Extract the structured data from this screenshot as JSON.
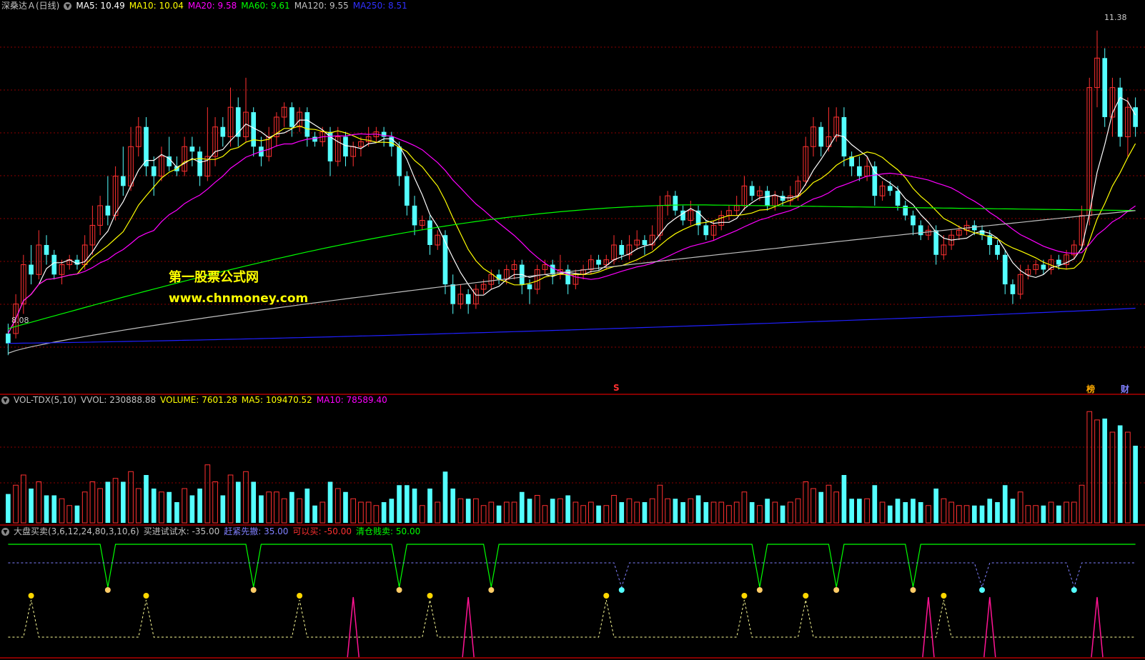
{
  "header_main": {
    "title": "深桑达Ａ(日线)",
    "ma5": "MA5: 10.49",
    "ma10": "MA10: 10.04",
    "ma20": "MA20: 9.58",
    "ma60": "MA60: 9.61",
    "ma120": "MA120: 9.55",
    "ma250": "MA250: 8.51"
  },
  "header_vol": {
    "name": "VOL-TDX(5,10)",
    "vvol": "VVOL: 230888.88",
    "volume": "VOLUME: 7601.28",
    "ma5": "MA5: 109470.52",
    "ma10": "MA10: 78589.40"
  },
  "header_ind": {
    "name": "大盘买卖(3,6,12,24,80,3,10,6)",
    "buy_try": "买进试试水: -35.00",
    "run_first": "赶紧先撤: 35.00",
    "can_buy": "可以买: -50.00",
    "clear_sell": "清仓贱卖: 50.00"
  },
  "watermark": {
    "line1": "第一股票公式网",
    "line2": "www.chnmoney.com"
  },
  "price_labels": {
    "high": "11.38",
    "low": "8.08"
  },
  "markers": {
    "s": "S",
    "bang": "榜",
    "cai": "财"
  },
  "colors": {
    "up": "#ff3030",
    "down": "#54ffff",
    "ma5": "#ffffff",
    "ma10": "#ffff00",
    "ma20": "#ff00ff",
    "ma60": "#00ff00",
    "ma120": "#c0c0c0",
    "ma250": "#2020ff",
    "grid": "#8b0000"
  },
  "chart_data": {
    "type": "candlestick",
    "y_range": [
      8.08,
      11.38
    ],
    "candles": [
      [
        8.2,
        8.3,
        8.08,
        8.4,
        "d"
      ],
      [
        8.3,
        8.6,
        8.25,
        8.7,
        "u"
      ],
      [
        8.6,
        9.0,
        8.5,
        9.1,
        "u"
      ],
      [
        9.0,
        8.9,
        8.8,
        9.2,
        "d"
      ],
      [
        8.9,
        9.2,
        8.85,
        9.35,
        "u"
      ],
      [
        9.2,
        9.1,
        9.0,
        9.3,
        "d"
      ],
      [
        9.1,
        8.9,
        8.85,
        9.15,
        "d"
      ],
      [
        8.9,
        9.0,
        8.8,
        9.05,
        "u"
      ],
      [
        9.0,
        9.05,
        8.95,
        9.1,
        "u"
      ],
      [
        9.05,
        9.0,
        8.95,
        9.1,
        "d"
      ],
      [
        9.0,
        9.2,
        8.95,
        9.3,
        "u"
      ],
      [
        9.2,
        9.4,
        9.1,
        9.6,
        "u"
      ],
      [
        9.4,
        9.6,
        9.3,
        9.7,
        "u"
      ],
      [
        9.6,
        9.5,
        9.4,
        9.9,
        "d"
      ],
      [
        9.5,
        9.9,
        9.45,
        10.0,
        "u"
      ],
      [
        9.9,
        9.8,
        9.7,
        10.2,
        "d"
      ],
      [
        9.8,
        10.2,
        9.75,
        10.4,
        "u"
      ],
      [
        10.2,
        10.4,
        10.1,
        10.5,
        "u"
      ],
      [
        10.4,
        10.0,
        9.9,
        10.5,
        "d"
      ],
      [
        10.0,
        9.9,
        9.7,
        10.1,
        "d"
      ],
      [
        9.9,
        10.1,
        9.85,
        10.2,
        "u"
      ],
      [
        10.1,
        10.0,
        9.95,
        10.3,
        "d"
      ],
      [
        10.0,
        9.95,
        9.9,
        10.1,
        "d"
      ],
      [
        9.95,
        10.2,
        9.9,
        10.3,
        "u"
      ],
      [
        10.2,
        10.15,
        10.0,
        10.3,
        "d"
      ],
      [
        10.15,
        9.9,
        9.8,
        10.2,
        "d"
      ],
      [
        9.9,
        10.1,
        9.85,
        10.6,
        "u"
      ],
      [
        10.1,
        10.4,
        10.0,
        10.5,
        "u"
      ],
      [
        10.4,
        10.3,
        10.2,
        10.5,
        "d"
      ],
      [
        10.3,
        10.6,
        10.2,
        10.8,
        "u"
      ],
      [
        10.6,
        10.3,
        10.2,
        10.7,
        "d"
      ],
      [
        10.3,
        10.55,
        10.25,
        10.9,
        "u"
      ],
      [
        10.55,
        10.2,
        10.1,
        10.6,
        "d"
      ],
      [
        10.2,
        10.1,
        10.0,
        10.3,
        "d"
      ],
      [
        10.1,
        10.3,
        10.05,
        10.4,
        "u"
      ],
      [
        10.3,
        10.5,
        10.2,
        10.55,
        "u"
      ],
      [
        10.5,
        10.6,
        10.4,
        10.65,
        "u"
      ],
      [
        10.6,
        10.4,
        10.3,
        10.65,
        "d"
      ],
      [
        10.4,
        10.55,
        10.35,
        10.6,
        "u"
      ],
      [
        10.55,
        10.3,
        10.2,
        10.6,
        "d"
      ],
      [
        10.3,
        10.25,
        10.2,
        10.35,
        "d"
      ],
      [
        10.25,
        10.35,
        10.2,
        10.4,
        "u"
      ],
      [
        10.35,
        10.05,
        9.9,
        10.4,
        "d"
      ],
      [
        10.05,
        10.3,
        10.0,
        10.4,
        "u"
      ],
      [
        10.3,
        10.1,
        10.0,
        10.35,
        "d"
      ],
      [
        10.1,
        10.2,
        10.0,
        10.25,
        "u"
      ],
      [
        10.2,
        10.25,
        10.1,
        10.3,
        "u"
      ],
      [
        10.25,
        10.3,
        10.2,
        10.4,
        "u"
      ],
      [
        10.3,
        10.35,
        10.25,
        10.4,
        "u"
      ],
      [
        10.35,
        10.3,
        10.2,
        10.4,
        "d"
      ],
      [
        10.3,
        10.2,
        10.1,
        10.35,
        "d"
      ],
      [
        10.2,
        9.9,
        9.8,
        10.25,
        "d"
      ],
      [
        9.9,
        9.6,
        9.5,
        9.95,
        "d"
      ],
      [
        9.6,
        9.4,
        9.3,
        9.7,
        "d"
      ],
      [
        9.4,
        9.45,
        9.35,
        9.5,
        "u"
      ],
      [
        9.45,
        9.2,
        9.1,
        9.5,
        "d"
      ],
      [
        9.2,
        9.3,
        9.15,
        9.35,
        "u"
      ],
      [
        9.3,
        8.8,
        8.7,
        9.35,
        "d"
      ],
      [
        8.8,
        8.6,
        8.5,
        8.9,
        "d"
      ],
      [
        8.6,
        8.7,
        8.55,
        8.8,
        "u"
      ],
      [
        8.7,
        8.6,
        8.5,
        8.75,
        "d"
      ],
      [
        8.6,
        8.75,
        8.55,
        8.8,
        "u"
      ],
      [
        8.75,
        8.8,
        8.7,
        8.85,
        "u"
      ],
      [
        8.8,
        8.9,
        8.75,
        8.95,
        "u"
      ],
      [
        8.9,
        8.85,
        8.8,
        8.95,
        "d"
      ],
      [
        8.85,
        8.95,
        8.8,
        9.0,
        "u"
      ],
      [
        8.95,
        9.0,
        8.85,
        9.05,
        "u"
      ],
      [
        9.0,
        8.8,
        8.7,
        9.05,
        "d"
      ],
      [
        8.8,
        8.75,
        8.6,
        8.85,
        "d"
      ],
      [
        8.75,
        8.95,
        8.7,
        9.0,
        "u"
      ],
      [
        8.95,
        9.0,
        8.9,
        9.05,
        "u"
      ],
      [
        9.0,
        8.9,
        8.8,
        9.05,
        "d"
      ],
      [
        8.9,
        8.95,
        8.85,
        9.1,
        "u"
      ],
      [
        8.95,
        8.8,
        8.7,
        9.0,
        "d"
      ],
      [
        8.8,
        8.9,
        8.75,
        8.95,
        "u"
      ],
      [
        8.9,
        8.95,
        8.85,
        9.0,
        "u"
      ],
      [
        8.95,
        9.05,
        8.9,
        9.1,
        "u"
      ],
      [
        9.05,
        9.0,
        8.95,
        9.1,
        "d"
      ],
      [
        9.0,
        9.05,
        8.95,
        9.1,
        "u"
      ],
      [
        9.05,
        9.2,
        9.0,
        9.3,
        "u"
      ],
      [
        9.2,
        9.1,
        9.05,
        9.25,
        "d"
      ],
      [
        9.1,
        9.2,
        9.05,
        9.3,
        "u"
      ],
      [
        9.2,
        9.25,
        9.15,
        9.35,
        "u"
      ],
      [
        9.25,
        9.2,
        9.1,
        9.3,
        "d"
      ],
      [
        9.2,
        9.3,
        9.15,
        9.4,
        "u"
      ],
      [
        9.3,
        9.6,
        9.25,
        9.7,
        "u"
      ],
      [
        9.6,
        9.7,
        9.5,
        9.75,
        "u"
      ],
      [
        9.7,
        9.55,
        9.5,
        9.75,
        "d"
      ],
      [
        9.55,
        9.45,
        9.4,
        9.6,
        "d"
      ],
      [
        9.45,
        9.55,
        9.4,
        9.65,
        "u"
      ],
      [
        9.55,
        9.4,
        9.3,
        9.6,
        "d"
      ],
      [
        9.4,
        9.3,
        9.25,
        9.45,
        "d"
      ],
      [
        9.3,
        9.4,
        9.25,
        9.45,
        "u"
      ],
      [
        9.4,
        9.5,
        9.35,
        9.55,
        "u"
      ],
      [
        9.5,
        9.55,
        9.45,
        9.6,
        "u"
      ],
      [
        9.55,
        9.6,
        9.5,
        9.7,
        "u"
      ],
      [
        9.6,
        9.8,
        9.55,
        9.9,
        "u"
      ],
      [
        9.8,
        9.7,
        9.65,
        9.85,
        "d"
      ],
      [
        9.7,
        9.75,
        9.65,
        9.8,
        "u"
      ],
      [
        9.75,
        9.6,
        9.55,
        9.8,
        "d"
      ],
      [
        9.6,
        9.7,
        9.55,
        9.75,
        "u"
      ],
      [
        9.7,
        9.65,
        9.6,
        9.75,
        "d"
      ],
      [
        9.65,
        9.7,
        9.6,
        9.8,
        "u"
      ],
      [
        9.7,
        9.85,
        9.65,
        9.9,
        "u"
      ],
      [
        9.85,
        10.2,
        9.8,
        10.3,
        "u"
      ],
      [
        10.2,
        10.4,
        10.1,
        10.5,
        "u"
      ],
      [
        10.4,
        10.2,
        10.1,
        10.45,
        "d"
      ],
      [
        10.2,
        10.3,
        10.15,
        10.6,
        "u"
      ],
      [
        10.3,
        10.5,
        10.25,
        10.6,
        "u"
      ],
      [
        10.5,
        10.1,
        10.0,
        10.6,
        "d"
      ],
      [
        10.1,
        10.0,
        9.9,
        10.15,
        "d"
      ],
      [
        10.0,
        9.9,
        9.85,
        10.1,
        "d"
      ],
      [
        9.9,
        10.0,
        9.85,
        10.1,
        "u"
      ],
      [
        10.0,
        9.7,
        9.6,
        10.05,
        "d"
      ],
      [
        9.7,
        9.8,
        9.65,
        9.85,
        "u"
      ],
      [
        9.8,
        9.75,
        9.7,
        9.85,
        "d"
      ],
      [
        9.75,
        9.6,
        9.55,
        9.8,
        "d"
      ],
      [
        9.6,
        9.5,
        9.45,
        9.65,
        "d"
      ],
      [
        9.5,
        9.4,
        9.3,
        9.55,
        "d"
      ],
      [
        9.4,
        9.3,
        9.25,
        9.45,
        "d"
      ],
      [
        9.3,
        9.35,
        9.25,
        9.4,
        "u"
      ],
      [
        9.35,
        9.1,
        9.0,
        9.4,
        "d"
      ],
      [
        9.1,
        9.2,
        9.05,
        9.3,
        "u"
      ],
      [
        9.2,
        9.3,
        9.15,
        9.35,
        "u"
      ],
      [
        9.3,
        9.35,
        9.25,
        9.4,
        "u"
      ],
      [
        9.35,
        9.4,
        9.3,
        9.45,
        "u"
      ],
      [
        9.4,
        9.35,
        9.3,
        9.45,
        "d"
      ],
      [
        9.35,
        9.3,
        9.25,
        9.4,
        "d"
      ],
      [
        9.3,
        9.2,
        9.1,
        9.35,
        "d"
      ],
      [
        9.2,
        9.1,
        9.05,
        9.25,
        "d"
      ],
      [
        9.1,
        8.8,
        8.7,
        9.15,
        "d"
      ],
      [
        8.8,
        8.7,
        8.6,
        8.85,
        "d"
      ],
      [
        8.7,
        8.9,
        8.65,
        9.0,
        "u"
      ],
      [
        8.9,
        8.95,
        8.85,
        9.0,
        "u"
      ],
      [
        8.95,
        9.0,
        8.9,
        9.05,
        "u"
      ],
      [
        9.0,
        8.95,
        8.9,
        9.05,
        "d"
      ],
      [
        8.95,
        9.05,
        8.9,
        9.1,
        "u"
      ],
      [
        9.05,
        9.0,
        8.95,
        9.1,
        "d"
      ],
      [
        9.0,
        9.1,
        8.95,
        9.15,
        "u"
      ],
      [
        9.1,
        9.2,
        9.05,
        9.25,
        "u"
      ],
      [
        9.2,
        9.5,
        9.15,
        9.6,
        "u"
      ],
      [
        9.5,
        10.8,
        9.4,
        10.9,
        "u"
      ],
      [
        10.8,
        11.1,
        10.6,
        11.38,
        "u"
      ],
      [
        11.1,
        10.5,
        10.4,
        11.2,
        "d"
      ],
      [
        10.5,
        10.8,
        10.3,
        10.9,
        "u"
      ],
      [
        10.8,
        10.3,
        10.2,
        10.9,
        "d"
      ],
      [
        10.3,
        10.6,
        10.1,
        10.7,
        "u"
      ],
      [
        10.6,
        10.4,
        10.3,
        10.7,
        "d"
      ]
    ],
    "ma5_end": 10.49,
    "ma10_end": 10.04,
    "ma20_end": 9.58,
    "ma60_end": 9.61,
    "ma120_end": 9.55,
    "ma250_end": 8.51
  }
}
